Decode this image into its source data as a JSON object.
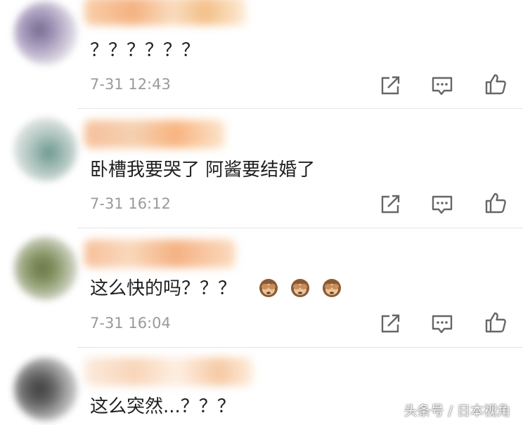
{
  "comments": [
    {
      "text": "？？？？？？",
      "time": "7-31 12:43"
    },
    {
      "text": "卧槽我要哭了 阿酱要结婚了",
      "time": "7-31 16:12"
    },
    {
      "text": "这么快的吗？？？",
      "time": "7-31 16:04"
    },
    {
      "text": "这么突然...？？？",
      "time": ""
    }
  ],
  "icons": {
    "share": "share-icon",
    "comment": "comment-icon",
    "like": "thumbs-up-icon",
    "emoji": "see-no-evil-monkey-emoji"
  },
  "watermark": "头条号 / 日本视角",
  "colors": {
    "text": "#1f1f1f",
    "time": "#9a9a9a",
    "icon": "#666666",
    "divider": "#e6e6e6"
  }
}
